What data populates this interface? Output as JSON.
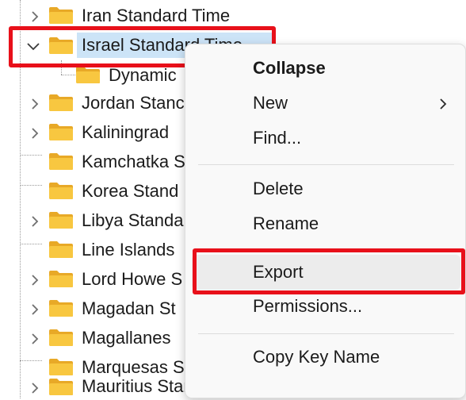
{
  "tree": {
    "items": [
      {
        "label": "Iran Standard Time",
        "expandable": true,
        "expanded": false
      },
      {
        "label": "Israel Standard Time",
        "expandable": true,
        "expanded": true,
        "selected": true
      },
      {
        "label": "Dynamic",
        "expandable": false,
        "child": true
      },
      {
        "label": "Jordan Stanc",
        "expandable": true,
        "expanded": false
      },
      {
        "label": "Kaliningrad",
        "expandable": true,
        "expanded": false
      },
      {
        "label": "Kamchatka S",
        "expandable": false
      },
      {
        "label": "Korea Stand",
        "expandable": false
      },
      {
        "label": "Libya Standa",
        "expandable": true,
        "expanded": false
      },
      {
        "label": "Line Islands",
        "expandable": false
      },
      {
        "label": "Lord Howe S",
        "expandable": true,
        "expanded": false
      },
      {
        "label": "Magadan St",
        "expandable": true,
        "expanded": false
      },
      {
        "label": "Magallanes",
        "expandable": true,
        "expanded": false
      },
      {
        "label": "Marquesas S",
        "expandable": false
      },
      {
        "label": "Mauritius Standard Time",
        "expandable": true,
        "expanded": false
      }
    ]
  },
  "context_menu": {
    "items": [
      {
        "label": "Collapse",
        "bold": true
      },
      {
        "label": "New",
        "submenu": true
      },
      {
        "label": "Find..."
      },
      {
        "separator": true
      },
      {
        "label": "Delete"
      },
      {
        "label": "Rename"
      },
      {
        "separator": true
      },
      {
        "label": "Export",
        "hover": true
      },
      {
        "label": "Permissions..."
      },
      {
        "separator": true
      },
      {
        "label": "Copy Key Name"
      }
    ]
  },
  "colors": {
    "highlight_red": "#e8101a",
    "selection": "#cce4f7",
    "folder": "#f8c740",
    "folder_dark": "#e8a927"
  }
}
